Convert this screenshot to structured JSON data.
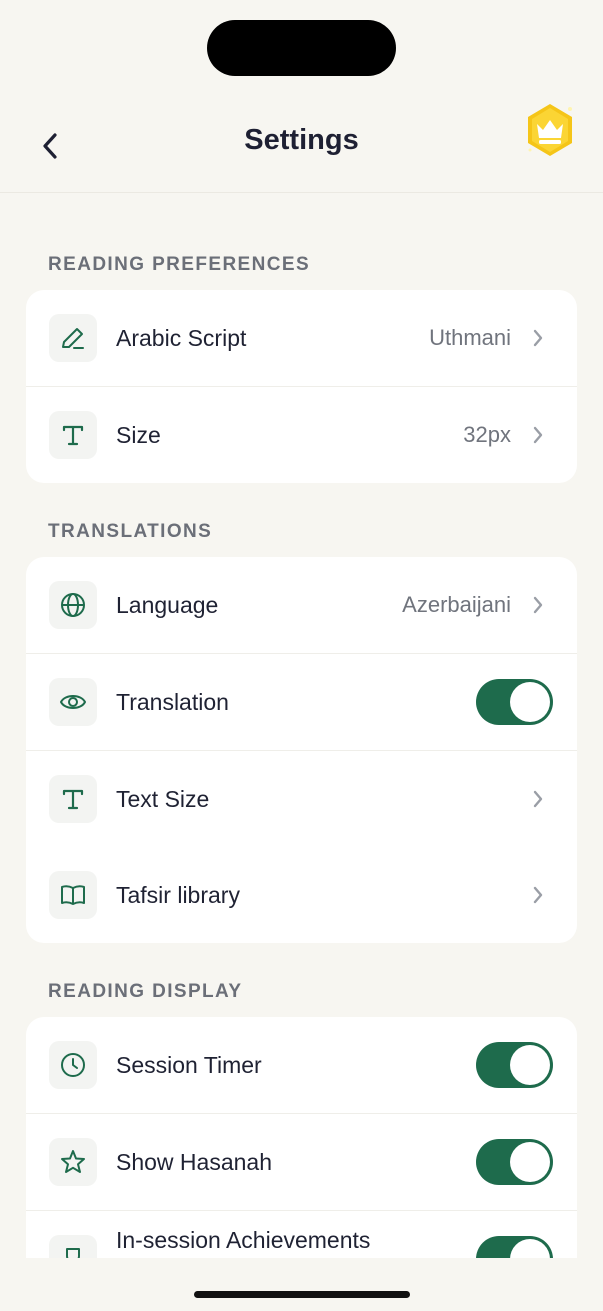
{
  "header": {
    "title": "Settings",
    "back_icon": "chevron-left-icon",
    "premium_icon": "crown-icon"
  },
  "sections": [
    {
      "label": "READING PREFERENCES",
      "items": [
        {
          "icon": "pen-icon",
          "label": "Arabic Script",
          "value": "Uthmani"
        },
        {
          "icon": "text-t-icon",
          "label": "Size",
          "value": "32px"
        }
      ]
    },
    {
      "label": "TRANSLATIONS",
      "items": [
        {
          "icon": "globe-icon",
          "label": "Language",
          "value": "Azerbaijani"
        },
        {
          "icon": "eye-icon",
          "label": "Translation",
          "toggle": true
        },
        {
          "icon": "text-t-icon",
          "label": "Text Size"
        },
        {
          "icon": "book-icon",
          "label": "Tafsir library"
        }
      ]
    },
    {
      "label": "READING DISPLAY",
      "items": [
        {
          "icon": "clock-icon",
          "label": "Session Timer",
          "toggle": true
        },
        {
          "icon": "star-icon",
          "label": "Show Hasanah",
          "toggle": true
        },
        {
          "icon": "trophy-icon",
          "label": "In-session Achievements",
          "toggle": true
        }
      ]
    }
  ],
  "colors": {
    "accent": "#1e6b4c",
    "background": "#f7f6f1",
    "crown": "#f5c518"
  }
}
